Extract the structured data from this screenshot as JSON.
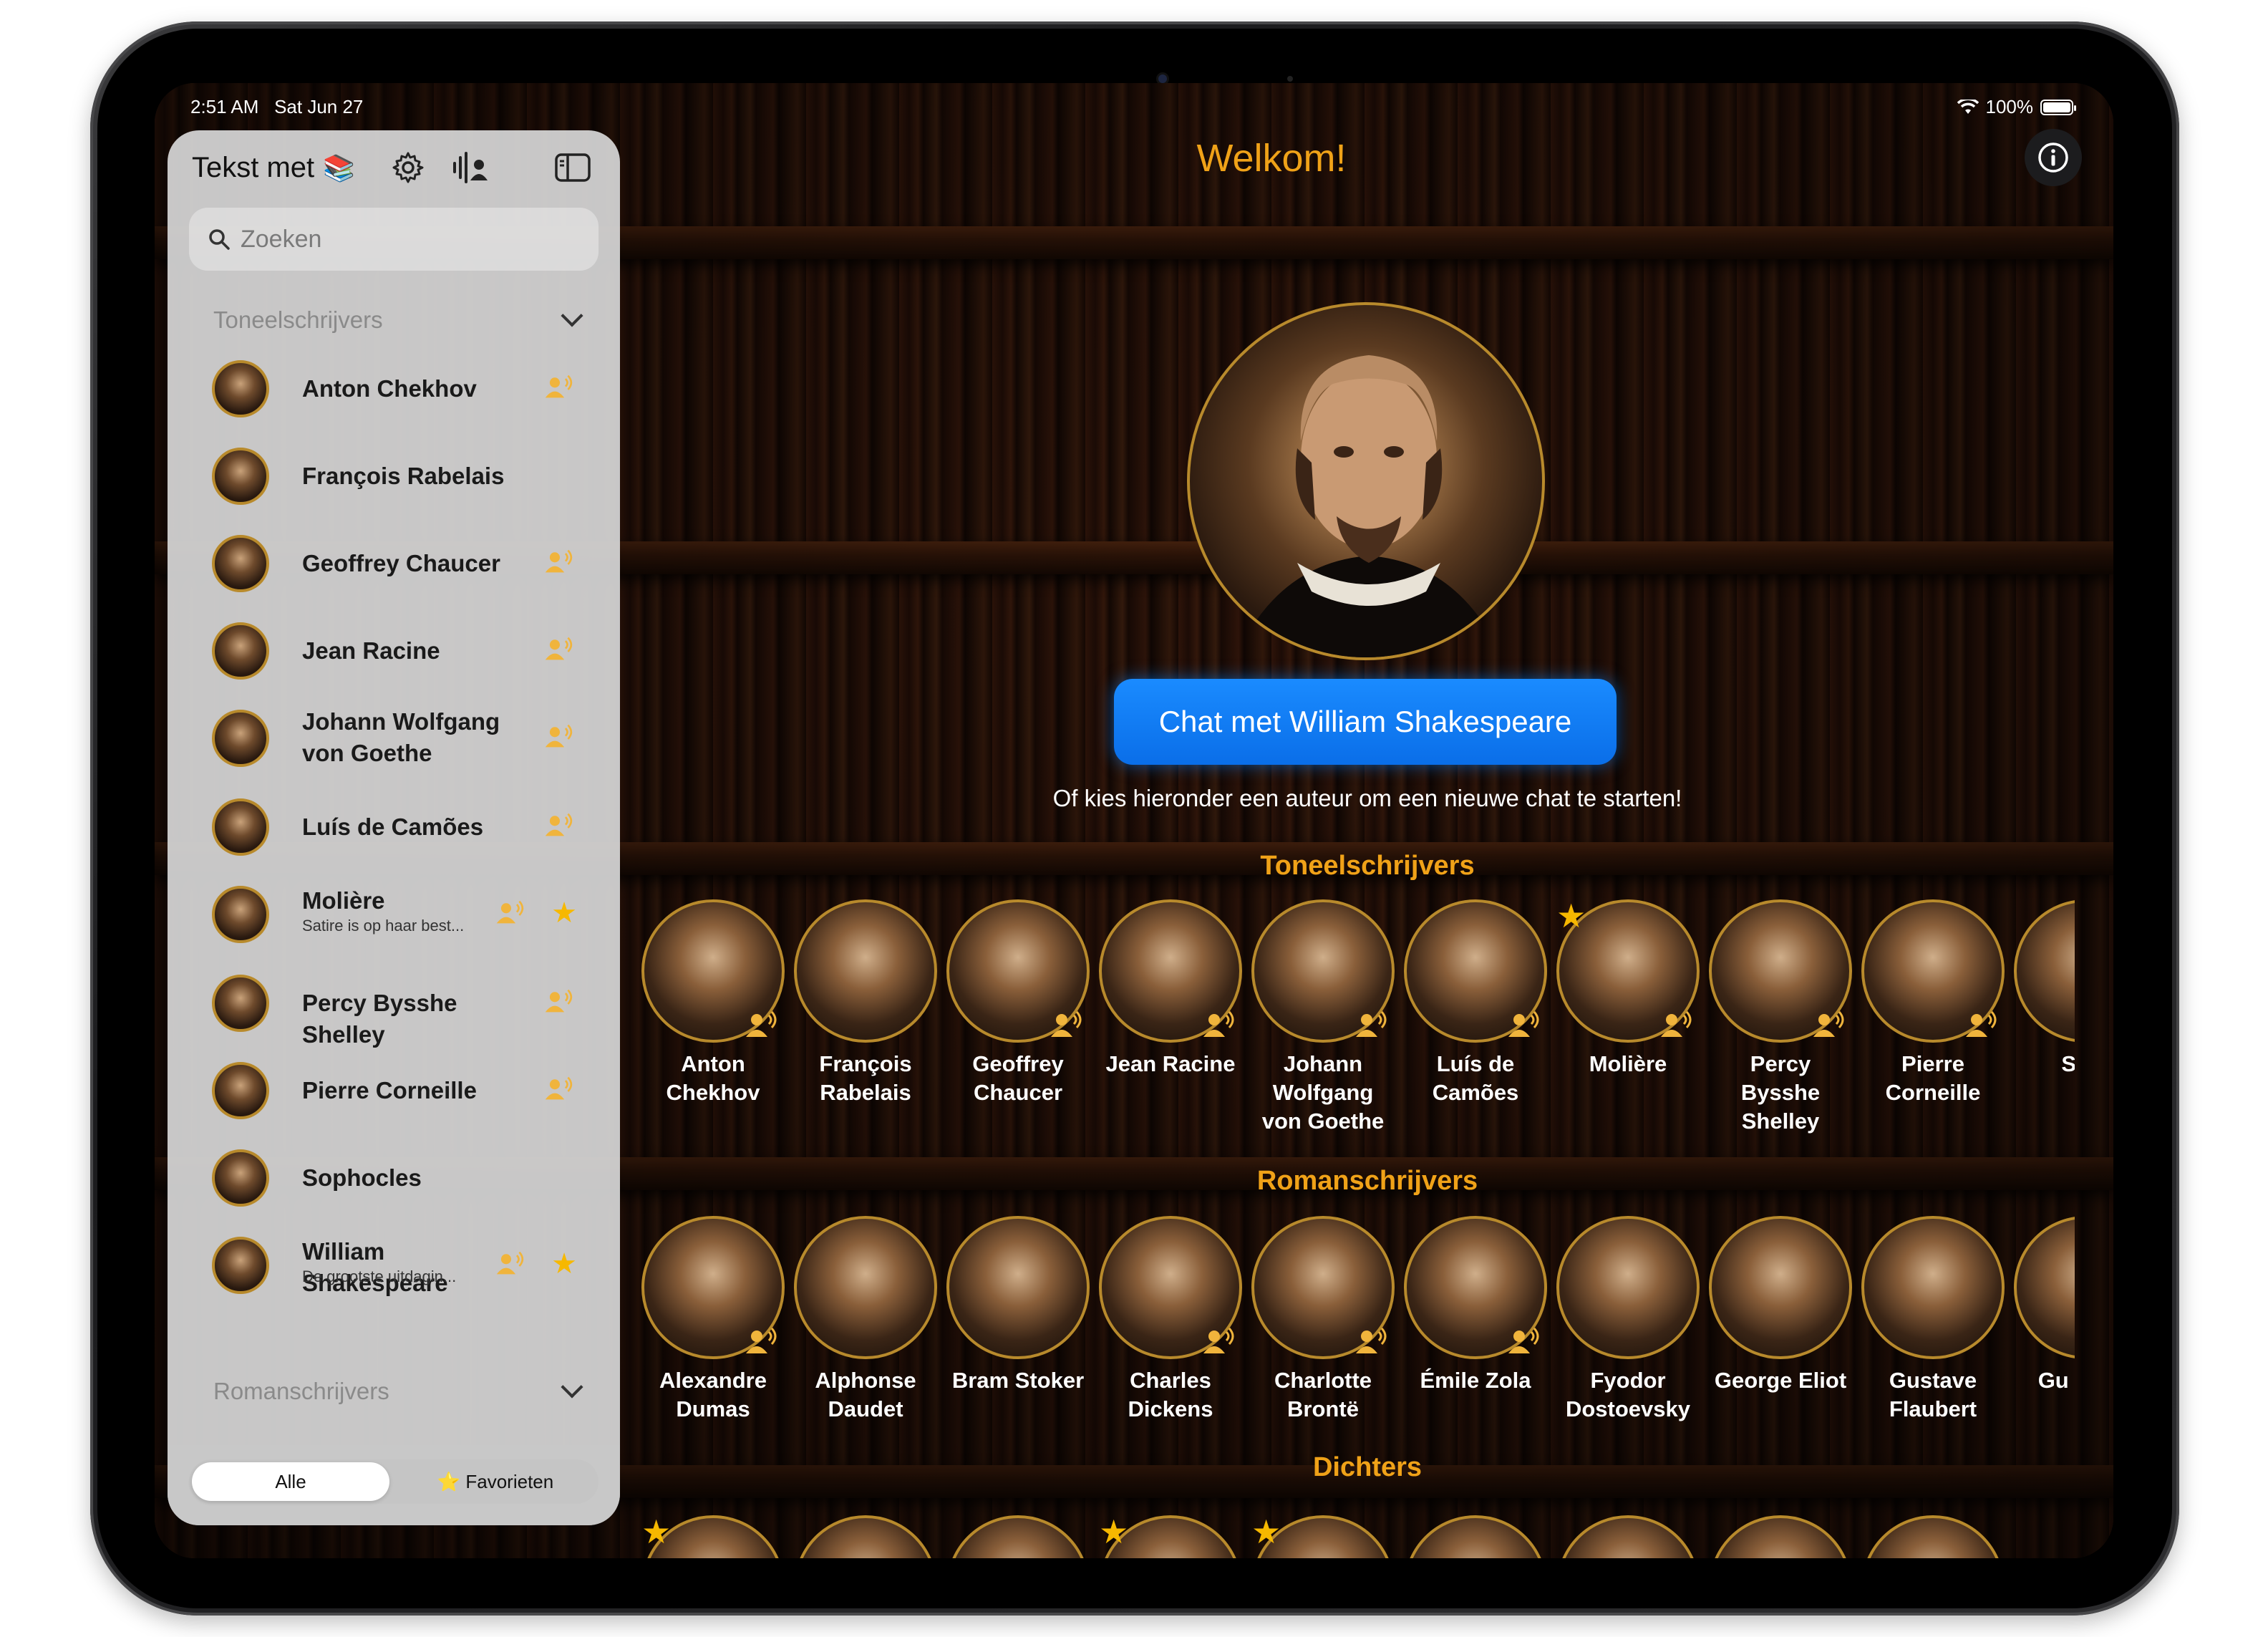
{
  "status": {
    "time": "2:51 AM",
    "date": "Sat Jun 27",
    "battery": "100%"
  },
  "sidebar": {
    "title": "Tekst met",
    "title_icon": "books-emoji",
    "search_placeholder": "Zoeken",
    "sections": [
      {
        "label": "Toneelschrijvers",
        "expanded": true
      },
      {
        "label": "Romanschrijvers",
        "expanded": true
      }
    ],
    "items": [
      {
        "name": "Anton Chekhov",
        "voice": true,
        "favorite": false,
        "preview": ""
      },
      {
        "name": "François Rabelais",
        "voice": false,
        "favorite": false,
        "preview": ""
      },
      {
        "name": "Geoffrey Chaucer",
        "voice": true,
        "favorite": false,
        "preview": ""
      },
      {
        "name": "Jean Racine",
        "voice": true,
        "favorite": false,
        "preview": ""
      },
      {
        "name": "Johann Wolfgang von Goethe",
        "voice": true,
        "favorite": false,
        "preview": ""
      },
      {
        "name": "Luís de Camões",
        "voice": true,
        "favorite": false,
        "preview": ""
      },
      {
        "name": "Molière",
        "voice": true,
        "favorite": true,
        "preview": "Satire is op haar best..."
      },
      {
        "name": "Percy Bysshe Shelley",
        "voice": true,
        "favorite": false,
        "preview": ""
      },
      {
        "name": "Pierre Corneille",
        "voice": true,
        "favorite": false,
        "preview": ""
      },
      {
        "name": "Sophocles",
        "voice": false,
        "favorite": false,
        "preview": ""
      },
      {
        "name": "William Shakespeare",
        "voice": true,
        "favorite": true,
        "preview": "De grootste uitdagin..."
      }
    ],
    "segments": {
      "all": "Alle",
      "favorites": "⭐ Favorieten",
      "selected": "Alle"
    }
  },
  "main": {
    "welcome": "Welkom!",
    "chat_button": "Chat met William Shakespeare",
    "hint": "Of kies hieronder een auteur om een nieuwe chat te starten!",
    "categories": [
      {
        "title": "Toneelschrijvers",
        "authors": [
          {
            "name": "Anton Chekhov",
            "voice": true,
            "favorite": false
          },
          {
            "name": "François Rabelais",
            "voice": false,
            "favorite": false
          },
          {
            "name": "Geoffrey Chaucer",
            "voice": true,
            "favorite": false
          },
          {
            "name": "Jean Racine",
            "voice": true,
            "favorite": false
          },
          {
            "name": "Johann Wolfgang von Goethe",
            "voice": true,
            "favorite": false
          },
          {
            "name": "Luís de Camões",
            "voice": true,
            "favorite": false
          },
          {
            "name": "Molière",
            "voice": true,
            "favorite": true
          },
          {
            "name": "Percy Bysshe Shelley",
            "voice": true,
            "favorite": false
          },
          {
            "name": "Pierre Corneille",
            "voice": true,
            "favorite": false
          },
          {
            "name": "Sopl",
            "voice": false,
            "favorite": false
          }
        ]
      },
      {
        "title": "Romanschrijvers",
        "authors": [
          {
            "name": "Alexandre Dumas",
            "voice": true,
            "favorite": false
          },
          {
            "name": "Alphonse Daudet",
            "voice": false,
            "favorite": false
          },
          {
            "name": "Bram Stoker",
            "voice": false,
            "favorite": false
          },
          {
            "name": "Charles Dickens",
            "voice": true,
            "favorite": false
          },
          {
            "name": "Charlotte Brontë",
            "voice": true,
            "favorite": false
          },
          {
            "name": "Émile Zola",
            "voice": true,
            "favorite": false
          },
          {
            "name": "Fyodor Dostoevsky",
            "voice": false,
            "favorite": false
          },
          {
            "name": "George Eliot",
            "voice": false,
            "favorite": false
          },
          {
            "name": "Gustave Flaubert",
            "voice": false,
            "favorite": false
          },
          {
            "name": "Gu Maup",
            "voice": false,
            "favorite": false
          }
        ]
      },
      {
        "title": "Dichters",
        "authors": [
          {
            "name": "",
            "favorite": true
          },
          {
            "name": "",
            "favorite": false
          },
          {
            "name": "",
            "favorite": false
          },
          {
            "name": "",
            "favorite": true
          },
          {
            "name": "",
            "favorite": true
          },
          {
            "name": "",
            "favorite": false
          },
          {
            "name": "",
            "favorite": false
          },
          {
            "name": "",
            "favorite": false
          },
          {
            "name": "",
            "favorite": false
          }
        ]
      }
    ]
  },
  "colors": {
    "accent": "#f0a218",
    "button": "#0a84ff",
    "sidebar": "#d6d6d6",
    "gold_ring": "#b88a2c",
    "star": "#f6b800"
  }
}
